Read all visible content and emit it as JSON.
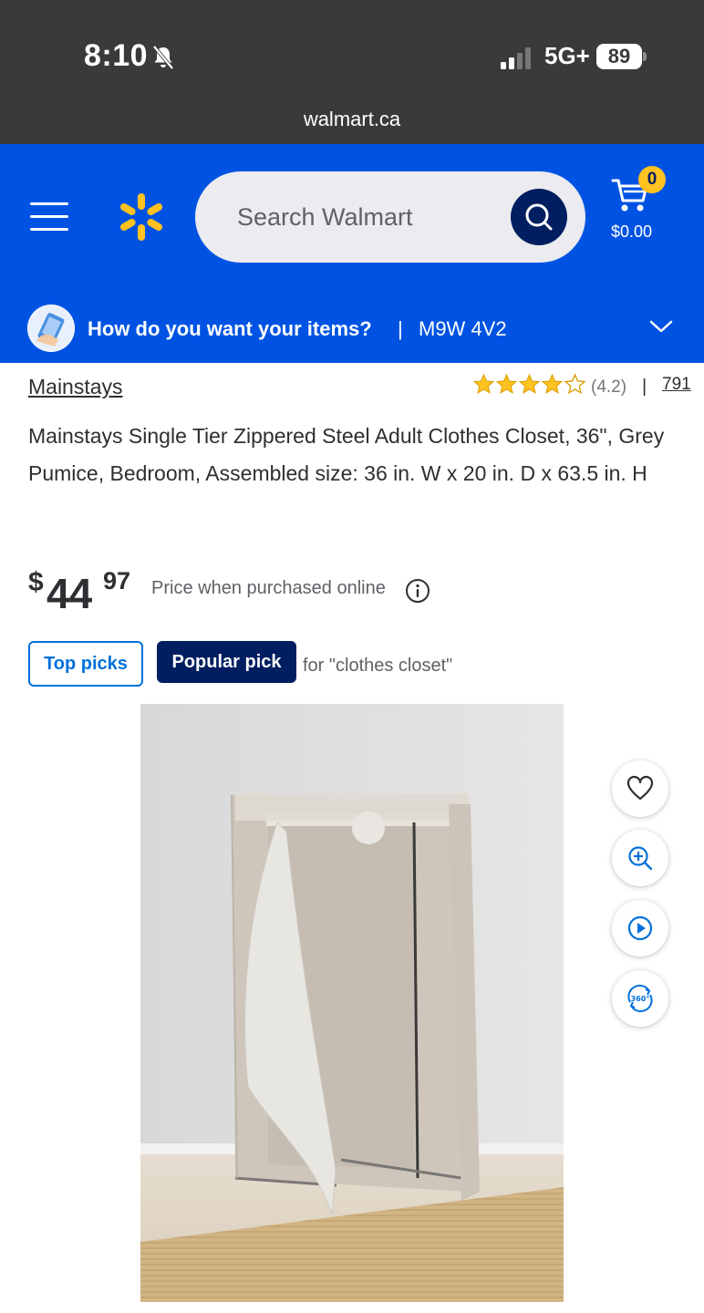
{
  "status_bar": {
    "time": "8:10",
    "network": "5G+",
    "battery": "89"
  },
  "browser": {
    "url": "walmart.ca"
  },
  "header": {
    "search_placeholder": "Search Walmart",
    "cart_count": "0",
    "cart_total": "$0.00",
    "delivery_question": "How do you want your items?",
    "delivery_separator": "|",
    "postal_code": "M9W 4V2"
  },
  "product": {
    "brand": "Mainstays",
    "rating": 4.2,
    "rating_max": 5,
    "rating_label": "(4.2)",
    "rating_separator": "|",
    "review_count": "791",
    "title": "Mainstays Single Tier Zippered Steel Adult Clothes Closet, 36\", Grey Pumice, Bedroom, Assembled size: 36 in. W x 20 in. D x 63.5 in. H",
    "price_currency": "$",
    "price_dollars": "44",
    "price_cents": "97",
    "price_note": "Price when purchased online",
    "badges": {
      "top_picks": "Top picks",
      "popular_pick": "Popular pick",
      "context": "for \"clothes closet\""
    }
  },
  "image_actions": [
    "heart-icon",
    "zoom-in-icon",
    "play-icon",
    "360-view-icon"
  ],
  "colors": {
    "walmart_blue": "#0053e2",
    "walmart_navy": "#001e60",
    "spark_yellow": "#ffc220",
    "link_blue": "#0071dc",
    "status_bar": "#3a3a3c"
  }
}
